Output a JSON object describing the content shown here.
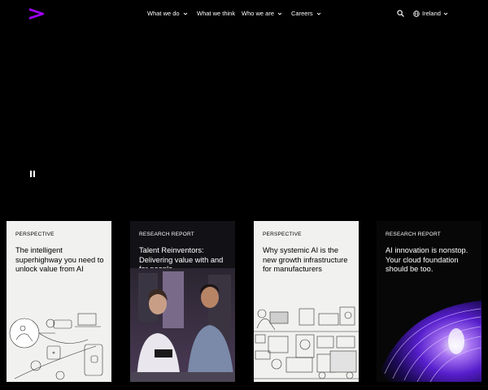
{
  "nav": {
    "items": [
      {
        "label": "What we do"
      },
      {
        "label": "What we think"
      },
      {
        "label": "Who we are"
      },
      {
        "label": "Careers"
      }
    ]
  },
  "region": {
    "label": "Ireland"
  },
  "cards": [
    {
      "tag": "PERSPECTIVE",
      "title": "The intelligent superhighway you need to unlock value from AI"
    },
    {
      "tag": "RESEARCH REPORT",
      "title": "Talent Reinventors: Delivering value with and for people"
    },
    {
      "tag": "PERSPECTIVE",
      "title": "Why systemic AI is the new growth infrastructure for manufacturers"
    },
    {
      "tag": "RESEARCH REPORT",
      "title": "AI innovation is nonstop. Your cloud foundation should be too."
    }
  ],
  "colors": {
    "brand": "#a100ff",
    "background": "#000000",
    "card_light": "#f1f1ef"
  }
}
